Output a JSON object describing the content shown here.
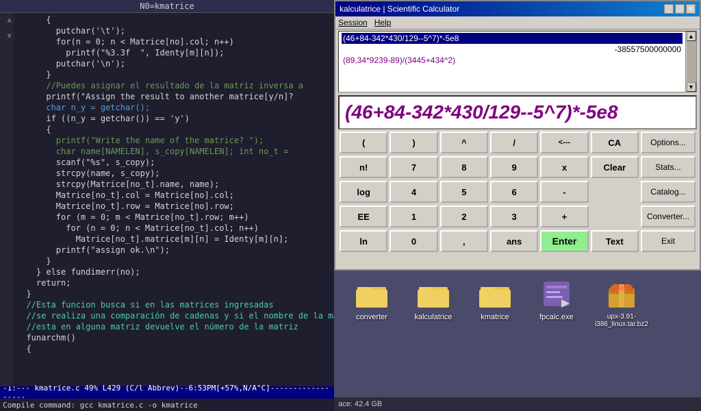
{
  "editor": {
    "title": "N0=kmatrice",
    "lines": [
      {
        "indent": "      ",
        "content": "{",
        "type": "normal"
      },
      {
        "indent": "        ",
        "content": "putchar('\\t');",
        "type": "normal"
      },
      {
        "indent": "        ",
        "content": "for(n = 0; n < Matrice[no].col; n++)",
        "type": "normal"
      },
      {
        "indent": "          ",
        "content": "printf(\"%3.3f  \", Identy[m][n]);",
        "type": "normal"
      },
      {
        "indent": "        ",
        "content": "putchar('\\n');",
        "type": "normal"
      },
      {
        "indent": "      ",
        "content": "}",
        "type": "normal"
      },
      {
        "indent": "      ",
        "content": "//Puedes asignar el resultado de la matriz inversa a",
        "type": "comment"
      },
      {
        "indent": "      ",
        "content": "printf(\"Assign the result to another matrice[y/n]?",
        "type": "normal"
      },
      {
        "indent": "      ",
        "content": "char n_y = getchar();",
        "type": "keyword"
      },
      {
        "indent": "      ",
        "content": "if ((n_y = getchar()) == 'y')",
        "type": "normal"
      },
      {
        "indent": "      ",
        "content": "{",
        "type": "normal"
      },
      {
        "indent": "        ",
        "content": "printf(\"Write the name of the matrice? \");",
        "type": "comment"
      },
      {
        "indent": "        ",
        "content": "char name[NAMELEN], s_copy[NAMELEN]; int no_t =",
        "type": "comment"
      },
      {
        "indent": "        ",
        "content": "scanf(\"%s\", s_copy);",
        "type": "normal"
      },
      {
        "indent": "        ",
        "content": "strcpy(name, s_copy);",
        "type": "normal"
      },
      {
        "indent": "        ",
        "content": "strcpy(Matrice[no_t].name, name);",
        "type": "normal"
      },
      {
        "indent": "        ",
        "content": "Matrice[no_t].col = Matrice[no].col;",
        "type": "normal"
      },
      {
        "indent": "        ",
        "content": "Matrice[no_t].row = Matrice[no].row;",
        "type": "normal"
      },
      {
        "indent": "        ",
        "content": "for (m = 0; m < Matrice[no_t].row; m++)",
        "type": "normal"
      },
      {
        "indent": "          ",
        "content": "for (n = 0; n < Matrice[no_t].col; n++)",
        "type": "normal"
      },
      {
        "indent": "            ",
        "content": "Matrice[no_t].matrice[m][n] = Identy[m][n];",
        "type": "normal"
      },
      {
        "indent": "        ",
        "content": "printf(\"assign ok.\\n\");",
        "type": "normal"
      },
      {
        "indent": "      ",
        "content": "}",
        "type": "normal"
      },
      {
        "indent": "    ",
        "content": "} else fundimerr(no);",
        "type": "normal"
      },
      {
        "indent": "    ",
        "content": "return;",
        "type": "normal"
      },
      {
        "indent": "  ",
        "content": "}",
        "type": "normal"
      },
      {
        "indent": "  ",
        "content": "//Esta funcion busca si en las matrices ingresadas",
        "type": "comment-green"
      },
      {
        "indent": "  ",
        "content": "//se realiza una comparación de cadenas y si el nombre de la matriz",
        "type": "comment-green"
      },
      {
        "indent": "  ",
        "content": "//esta en alguna matriz devuelve el número de la matriz",
        "type": "comment-green"
      },
      {
        "indent": "  ",
        "content": "funarchm()",
        "type": "normal"
      },
      {
        "indent": "  ",
        "content": "{",
        "type": "normal"
      }
    ],
    "status_bar": "-1:---   kmatrice.c     49% L429   (C/l Abbrev)--6:53PM[+57%,N/A°C]------------------",
    "cmd_bar": "Compile command: gcc kmatrice.c -o kmatrice"
  },
  "calculator": {
    "title": "kalculatrice | Scientific Calculator",
    "window_buttons": {
      "minimize": "_",
      "maximize": "□",
      "close": "✕"
    },
    "menu": {
      "session": "Session",
      "help": "Help"
    },
    "history": [
      {
        "text": "(46+84-342*430/129--5^7)*-5e8",
        "type": "selected"
      },
      {
        "text": "-38557500000000",
        "type": "result"
      },
      {
        "text": "(89,34*9239-89)/(3445+434^2)",
        "type": "normal"
      }
    ],
    "display": "(46+84-342*430/129--5^7)*-5e8",
    "buttons": {
      "row1": [
        "(",
        ")",
        "^",
        "/",
        "<---",
        "CA",
        "Options..."
      ],
      "row2": [
        "n!",
        "7",
        "8",
        "9",
        "x",
        "",
        "Clear",
        "Stats..."
      ],
      "row3": [
        "log",
        "4",
        "5",
        "6",
        "-",
        "",
        "",
        "Catalog..."
      ],
      "row4": [
        "EE",
        "1",
        "2",
        "3",
        "+",
        "",
        "",
        "Converter..."
      ],
      "row5": [
        "ln",
        "0",
        ",",
        "ans",
        "Enter",
        "",
        "Text",
        "Exit"
      ]
    }
  },
  "desktop": {
    "icons": [
      {
        "label": "converter",
        "type": "folder"
      },
      {
        "label": "kalculatrice",
        "type": "folder"
      },
      {
        "label": "kmatrice",
        "type": "folder"
      },
      {
        "label": "fpcalc.exe",
        "type": "exe"
      },
      {
        "label": "upx-3.91-i386_linux.tar.bz2",
        "type": "archive"
      }
    ],
    "status": "ace: 42.4 GB"
  }
}
